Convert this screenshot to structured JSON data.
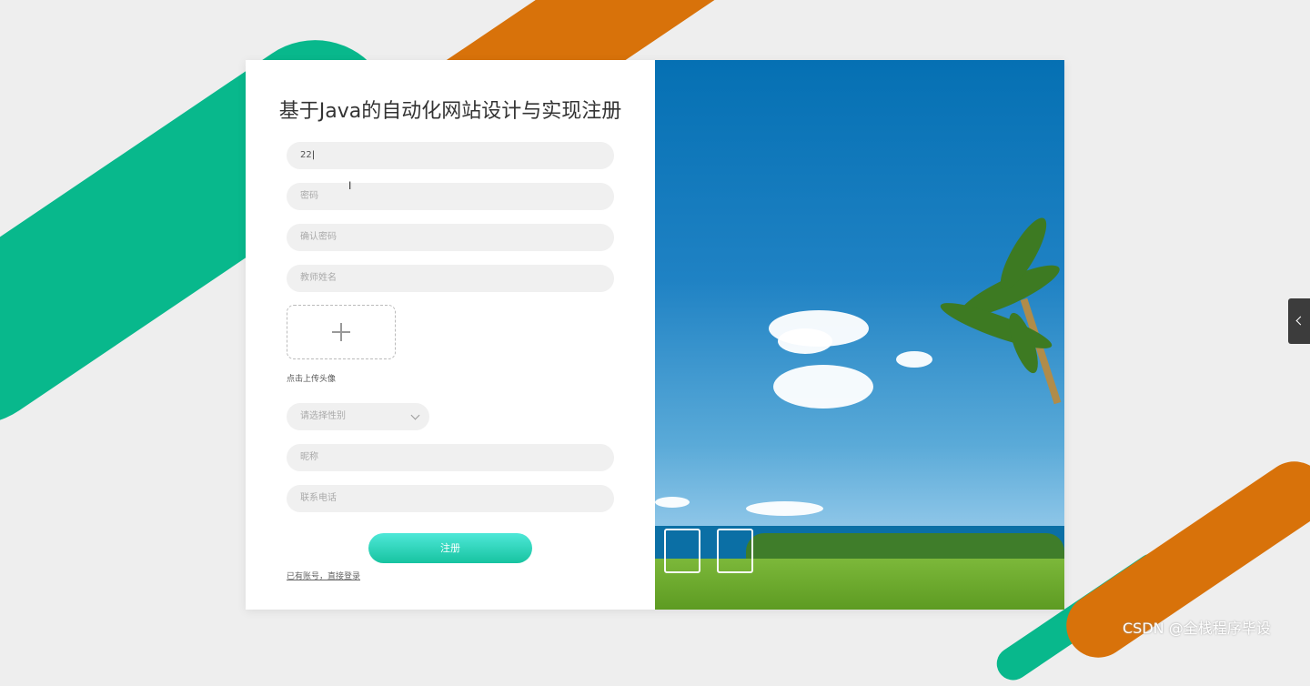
{
  "page": {
    "title": "基于Java的自动化网站设计与实现注册"
  },
  "form": {
    "username_value": "22",
    "password_placeholder": "密码",
    "confirm_password_placeholder": "确认密码",
    "teacher_name_placeholder": "教师姓名",
    "upload_hint": "点击上传头像",
    "gender_placeholder": "请选择性别",
    "nickname_placeholder": "昵称",
    "phone_placeholder": "联系电话",
    "register_label": "注册",
    "login_link": "已有账号，直接登录"
  },
  "colors": {
    "accent_green": "#08b88c",
    "accent_orange": "#d8720a",
    "button_gradient_top": "#4ee8d8",
    "button_gradient_bottom": "#17c3a0"
  },
  "icons": {
    "upload": "plus-icon",
    "gender_dropdown": "chevron-down-icon",
    "side_tab": "chevron-left-icon"
  },
  "watermark": "CSDN @全栈程序毕设"
}
